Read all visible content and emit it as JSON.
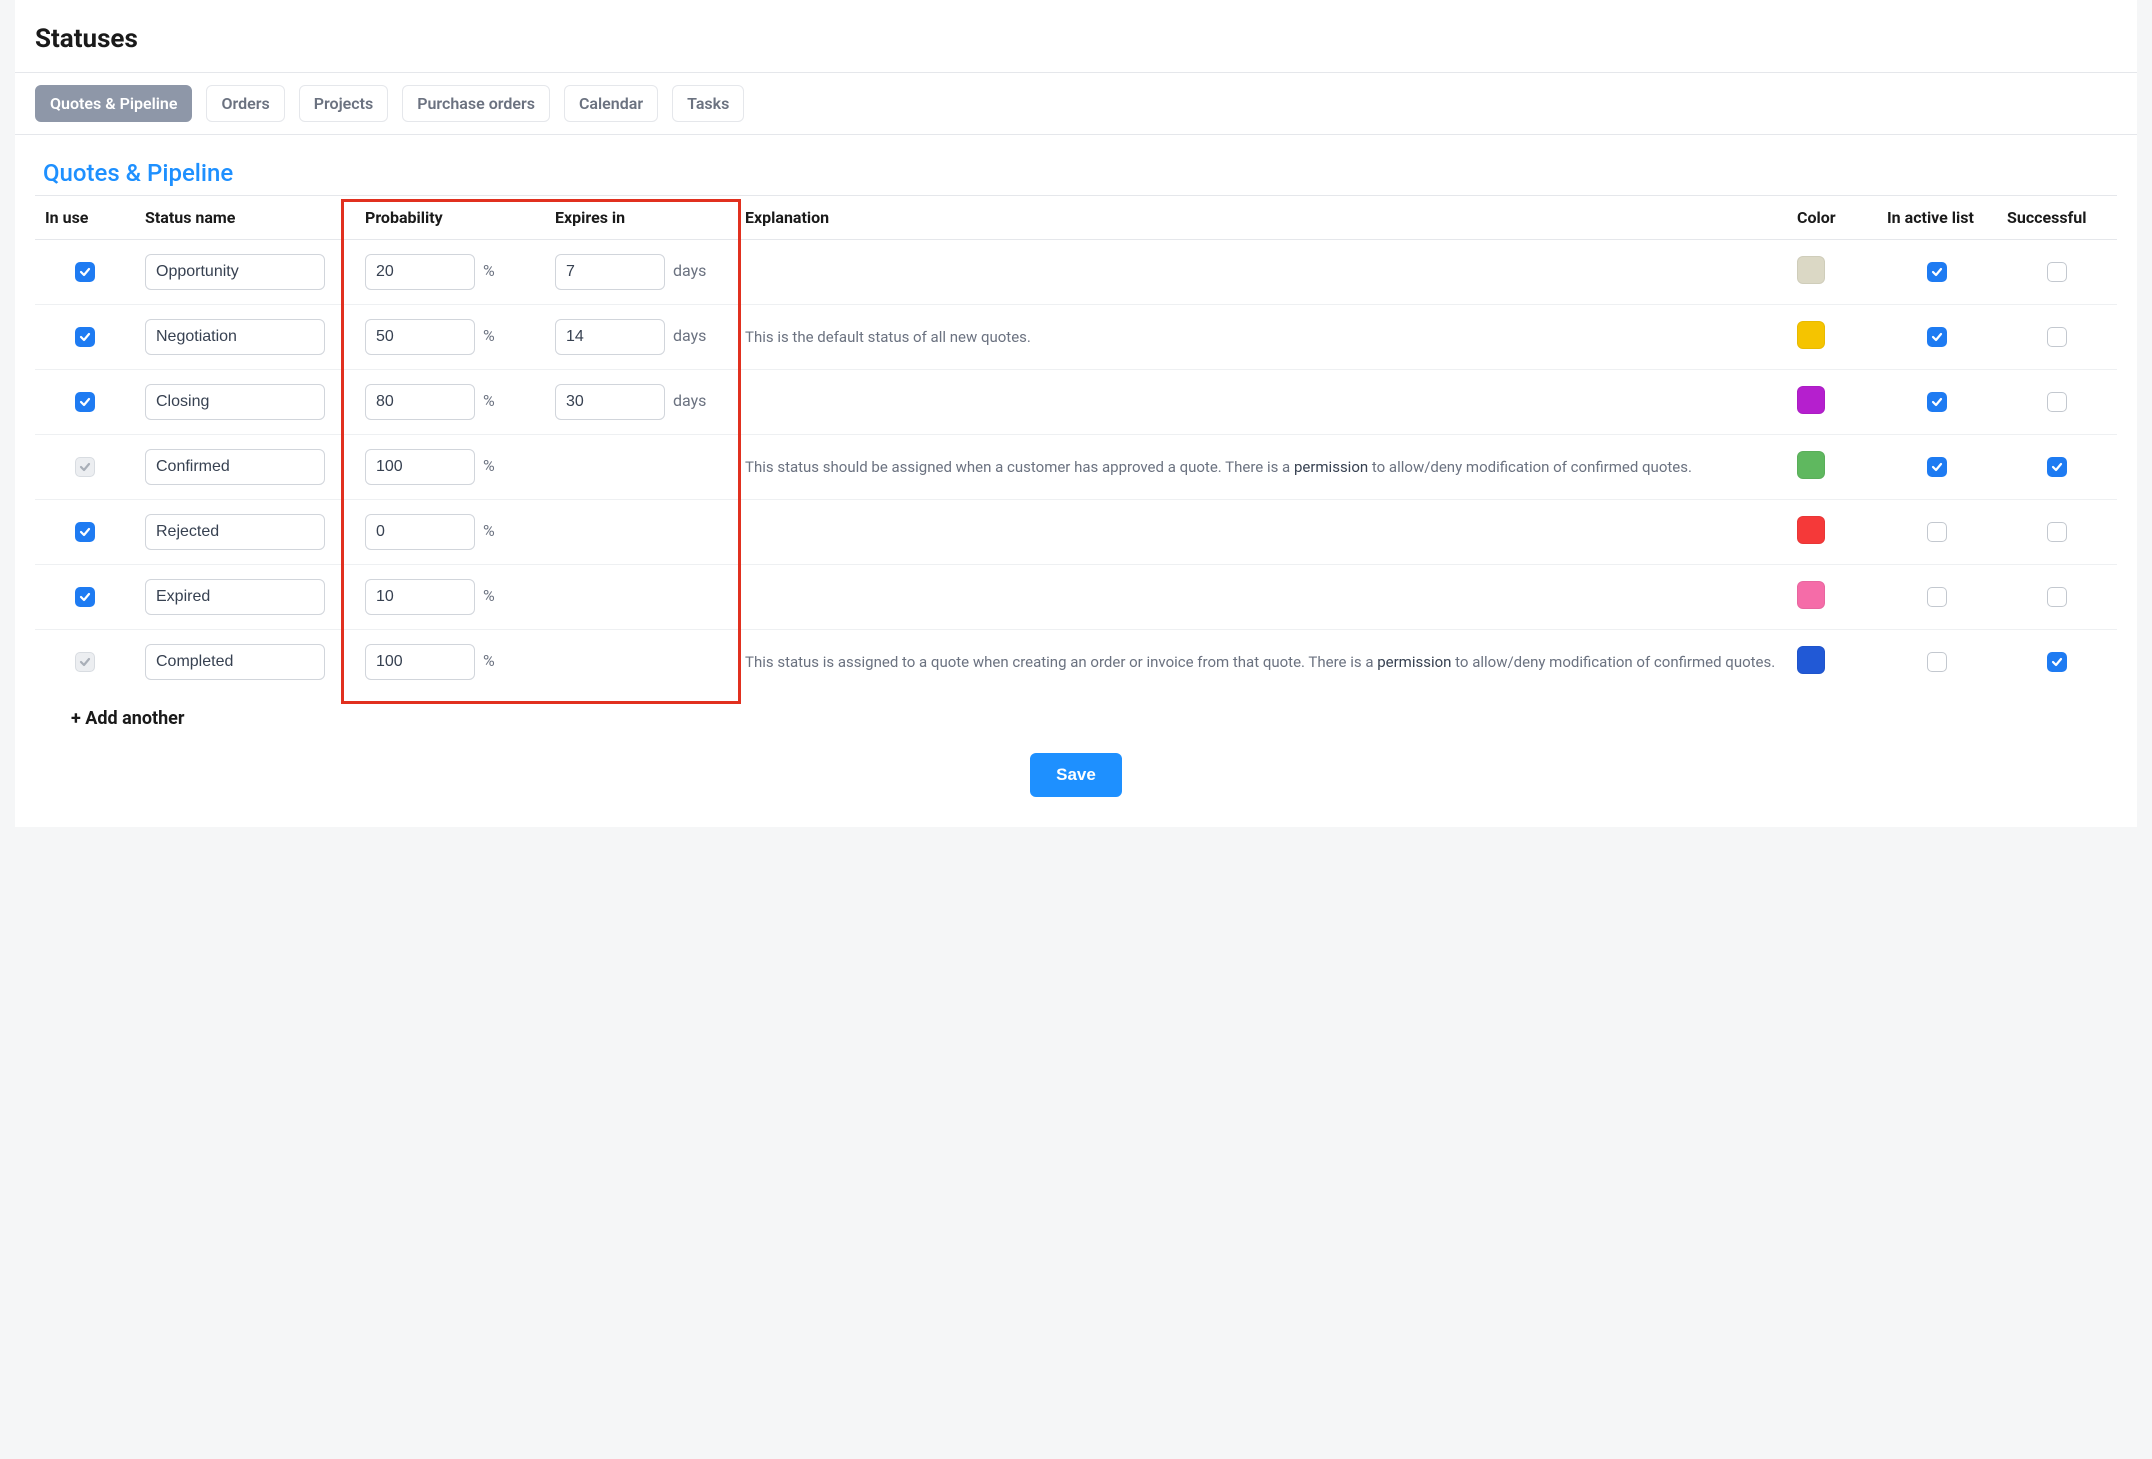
{
  "page_title": "Statuses",
  "tabs": [
    {
      "label": "Quotes & Pipeline",
      "active": true
    },
    {
      "label": "Orders",
      "active": false
    },
    {
      "label": "Projects",
      "active": false
    },
    {
      "label": "Purchase orders",
      "active": false
    },
    {
      "label": "Calendar",
      "active": false
    },
    {
      "label": "Tasks",
      "active": false
    }
  ],
  "section_title": "Quotes & Pipeline",
  "columns": {
    "in_use": "In use",
    "status_name": "Status name",
    "probability": "Probability",
    "expires_in": "Expires in",
    "explanation": "Explanation",
    "color": "Color",
    "in_active_list": "In active list",
    "successful": "Successful"
  },
  "units": {
    "percent": "%",
    "days": "days"
  },
  "rows": [
    {
      "in_use": {
        "checked": true,
        "disabled": false
      },
      "name": "Opportunity",
      "probability": "20",
      "expires": "7",
      "show_expires": true,
      "explanation": "",
      "explanation_has_permission": false,
      "color": "#dbd8c5",
      "in_active": {
        "checked": true,
        "disabled": false
      },
      "successful": {
        "checked": false,
        "disabled": false
      }
    },
    {
      "in_use": {
        "checked": true,
        "disabled": false
      },
      "name": "Negotiation",
      "probability": "50",
      "expires": "14",
      "show_expires": true,
      "explanation": "This is the default status of all new quotes.",
      "explanation_has_permission": false,
      "color": "#f5c400",
      "in_active": {
        "checked": true,
        "disabled": false
      },
      "successful": {
        "checked": false,
        "disabled": false
      }
    },
    {
      "in_use": {
        "checked": true,
        "disabled": false
      },
      "name": "Closing",
      "probability": "80",
      "expires": "30",
      "show_expires": true,
      "explanation": "",
      "explanation_has_permission": false,
      "color": "#b51fce",
      "in_active": {
        "checked": true,
        "disabled": false
      },
      "successful": {
        "checked": false,
        "disabled": false
      }
    },
    {
      "in_use": {
        "checked": true,
        "disabled": true
      },
      "name": "Confirmed",
      "probability": "100",
      "expires": "",
      "show_expires": false,
      "explanation_pre": "This status should be assigned when a customer has approved a quote. There is a ",
      "explanation_perm": "permission",
      "explanation_post": " to allow/deny modification of confirmed quotes.",
      "explanation_has_permission": true,
      "color": "#5fb85f",
      "in_active": {
        "checked": true,
        "disabled": false
      },
      "successful": {
        "checked": true,
        "disabled": false
      }
    },
    {
      "in_use": {
        "checked": true,
        "disabled": false
      },
      "name": "Rejected",
      "probability": "0",
      "expires": "",
      "show_expires": false,
      "explanation": "",
      "explanation_has_permission": false,
      "color": "#f53939",
      "in_active": {
        "checked": false,
        "disabled": false
      },
      "successful": {
        "checked": false,
        "disabled": false
      }
    },
    {
      "in_use": {
        "checked": true,
        "disabled": false
      },
      "name": "Expired",
      "probability": "10",
      "expires": "",
      "show_expires": false,
      "explanation": "",
      "explanation_has_permission": false,
      "color": "#f56ca8",
      "in_active": {
        "checked": false,
        "disabled": false
      },
      "successful": {
        "checked": false,
        "disabled": false
      }
    },
    {
      "in_use": {
        "checked": true,
        "disabled": true
      },
      "name": "Completed",
      "probability": "100",
      "expires": "",
      "show_expires": false,
      "explanation_pre": "This status is assigned to a quote when creating an order or invoice from that quote. There is a ",
      "explanation_perm": "permission",
      "explanation_post": " to allow/deny modification of confirmed quotes.",
      "explanation_has_permission": true,
      "color": "#2159d6",
      "in_active": {
        "checked": false,
        "disabled": false
      },
      "successful": {
        "checked": true,
        "disabled": false
      }
    }
  ],
  "add_another_label": "+ Add another",
  "save_label": "Save"
}
